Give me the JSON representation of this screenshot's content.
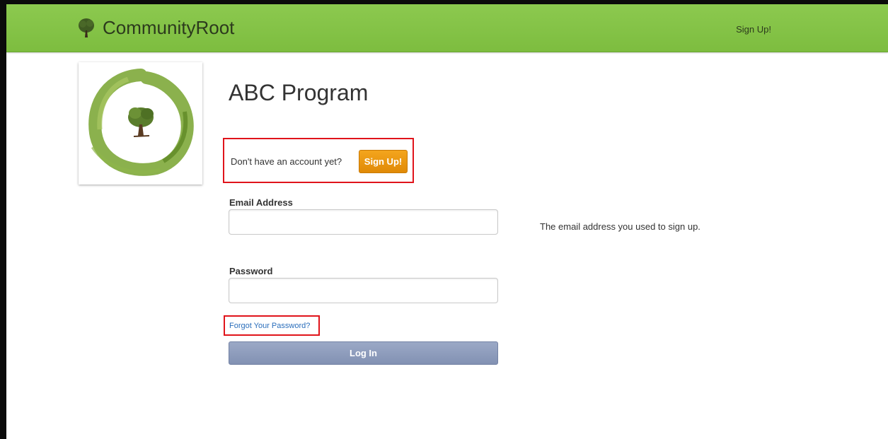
{
  "navbar": {
    "brand": "CommunityRoot",
    "brand_icon": "tree-icon",
    "signup_link": "Sign Up!"
  },
  "logo": {
    "icon": "tree-in-circle-logo"
  },
  "main": {
    "title": "ABC Program",
    "signup_prompt": "Don't have an account yet?",
    "signup_button": "Sign Up!",
    "email": {
      "label": "Email Address",
      "value": "",
      "placeholder": "",
      "help": "The email address you used to sign up."
    },
    "password": {
      "label": "Password",
      "value": "",
      "placeholder": ""
    },
    "forgot_password": "Forgot Your Password?",
    "login_button": "Log In"
  },
  "colors": {
    "navbar_green": "#8cc94f",
    "signup_orange": "#f0a01a",
    "login_blue_gray": "#8f9dbd",
    "highlight_red": "#e0141b",
    "link_blue": "#2a6ebb"
  }
}
